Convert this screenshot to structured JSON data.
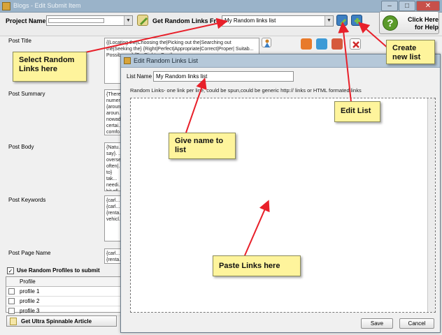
{
  "window": {
    "title": "Blogs - Edit Submit Item"
  },
  "toolbar": {
    "project_label": "Project Name:",
    "random_links_label": "Get Random Links From:",
    "random_links_value": "My Random links list",
    "help_button_label": "Click Here for Help"
  },
  "fields": {
    "post_title": "Post Title",
    "post_summary": "Post Summary",
    "post_body": "Post Body",
    "post_keywords": "Post Keywords",
    "post_page_name": "Post Page Name"
  },
  "field_snippets": {
    "title": "{{Locating the|Choosing the|Picking out the|Searching out the|Seeking the} {Right|Perfect|Appropriate|Correct|Proper| Suitab... Possib... as} {F... Right... Best}",
    "summary": "{There... numer... {aroun... aroun... nowad... certai... comfo...",
    "body": "{Natu... say}. ... overse... often|... to} tak... needi... bit of|...",
    "keywords": "{carl... {carl... {renta... vehicl...",
    "page_name": "{carl... {renta..."
  },
  "profiles": {
    "use_random_label": "Use Random Profiles to submit",
    "column_header": "Profile",
    "items": [
      "profile 1",
      "profile 2",
      "profile 3"
    ]
  },
  "bottom_button_label": "Get Ultra Spinnable Article",
  "dialog": {
    "title": "Edit Random Links List",
    "list_name_label": "List Name",
    "list_name_value": "My Random links list",
    "hint": "Random Links- one link per line, could be spun,could be generic http:// links or HTML formated links",
    "save_label": "Save",
    "cancel_label": "Cancel"
  },
  "callouts": {
    "select": "Select Random Links here",
    "create": "Create new list",
    "edit": "Edit List",
    "give_name": "Give name to list",
    "paste": "Paste Links here"
  },
  "colors": {
    "callout_bg": "#fef49c",
    "arrow": "#e8202a",
    "titlebar": "#9ab3c9"
  }
}
